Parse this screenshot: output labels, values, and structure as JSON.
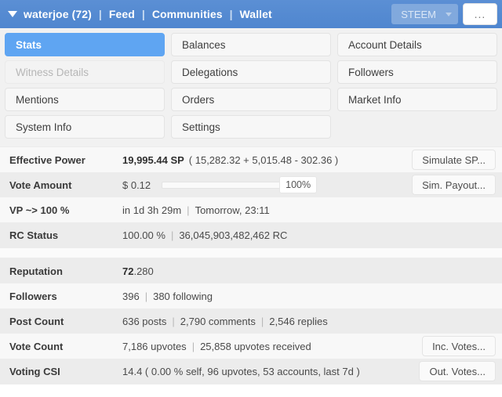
{
  "navbar": {
    "account_caret": "caret-down-icon",
    "account": "waterjoe (72)",
    "links": [
      "Feed",
      "Communities",
      "Wallet"
    ],
    "separator": "|",
    "coin": "STEEM",
    "more_label": "..."
  },
  "tabs": [
    {
      "label": "Stats",
      "state": "active"
    },
    {
      "label": "Balances",
      "state": "normal"
    },
    {
      "label": "Account Details",
      "state": "normal"
    },
    {
      "label": "Witness Details",
      "state": "disabled"
    },
    {
      "label": "Delegations",
      "state": "normal"
    },
    {
      "label": "Followers",
      "state": "normal"
    },
    {
      "label": "Mentions",
      "state": "normal"
    },
    {
      "label": "Orders",
      "state": "normal"
    },
    {
      "label": "Market Info",
      "state": "normal"
    },
    {
      "label": "System Info",
      "state": "normal"
    },
    {
      "label": "Settings",
      "state": "normal"
    },
    {
      "label": "",
      "state": "empty"
    }
  ],
  "table_power": {
    "effective_power": {
      "label": "Effective Power",
      "value_bold": "19,995.44 SP",
      "value_rest": "( 15,282.32 + 5,015.48 - 302.36 )",
      "button": "Simulate SP..."
    },
    "vote_amount": {
      "label": "Vote Amount",
      "value": "$ 0.12",
      "slider_percent": "100%",
      "button": "Sim. Payout..."
    },
    "vp_recharge": {
      "label": "VP ~> 100 %",
      "value_a": "in 1d 3h 29m",
      "value_b": "Tomorrow, 23:11"
    },
    "rc_status": {
      "label": "RC Status",
      "value_a": "100.00 %",
      "value_b": "36,045,903,482,462 RC"
    }
  },
  "table_social": {
    "reputation": {
      "label": "Reputation",
      "value_bold": "72",
      "value_rest": ".280"
    },
    "followers": {
      "label": "Followers",
      "value_a": "396",
      "value_b": "380 following"
    },
    "post_count": {
      "label": "Post Count",
      "value_a": "636 posts",
      "value_b": "2,790 comments",
      "value_c": "2,546 replies"
    },
    "vote_count": {
      "label": "Vote Count",
      "value_a": "7,186 upvotes",
      "value_b": "25,858 upvotes received",
      "button": "Inc. Votes..."
    },
    "voting_csi": {
      "label": "Voting CSI",
      "value": "14.4 ( 0.00 % self, 96 upvotes, 53 accounts, last 7d )",
      "button": "Out. Votes..."
    }
  },
  "colors": {
    "navbar": "#4f86cf",
    "accent_active_tab": "#5fa5f2",
    "row_odd": "#ececec",
    "row_even": "#f8f8f8"
  }
}
